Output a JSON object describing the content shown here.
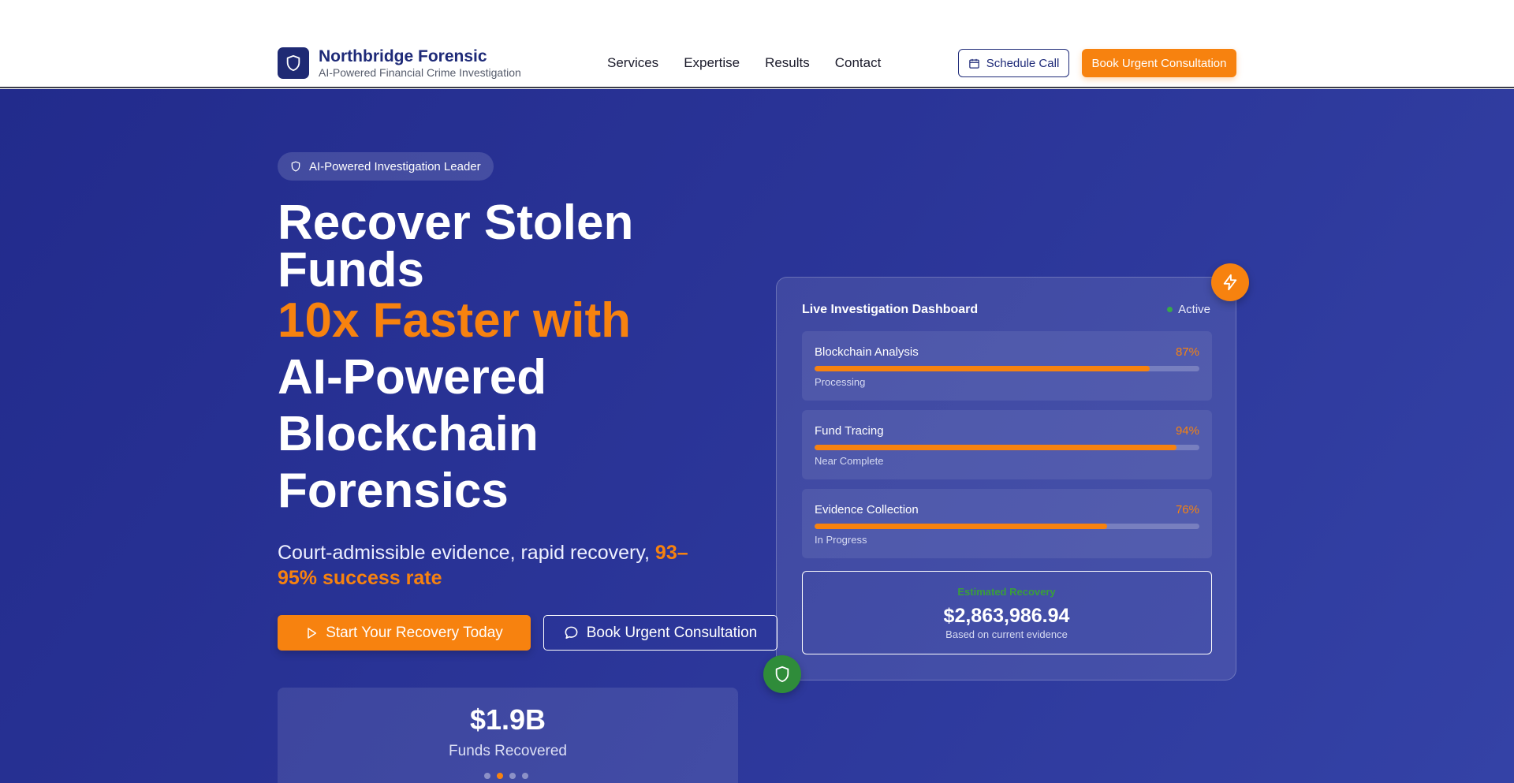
{
  "brand": {
    "title": "Northbridge Forensic",
    "subtitle": "AI-Powered Financial Crime Investigation",
    "logo_icon": "shield-icon"
  },
  "nav": {
    "items": [
      "Services",
      "Expertise",
      "Results",
      "Contact"
    ]
  },
  "header_actions": {
    "schedule_label": "Schedule Call",
    "schedule_icon": "calendar-icon",
    "urgent_label": "Book Urgent Consultation"
  },
  "hero": {
    "badge": "AI-Powered Investigation Leader",
    "headline": {
      "line1": "Recover Stolen",
      "line2": "Funds",
      "line3": "10x Faster with",
      "line4": "AI-Powered",
      "line5": "Blockchain",
      "line6": "Forensics"
    },
    "subtitle": "Court-admissible evidence, rapid recovery,",
    "subtitle_accent": "93–95% success rate",
    "cta_primary": "Start Your Recovery Today",
    "cta_secondary": "Book Urgent Consultation"
  },
  "stat": {
    "value": "$1.9B",
    "label": "Funds Recovered",
    "dots": 4,
    "active_dot": 1
  },
  "dashboard": {
    "title": "Live Investigation Dashboard",
    "status": "Active",
    "tasks": [
      {
        "name": "Blockchain Analysis",
        "percent": "87%",
        "progress": 87,
        "state": "Processing"
      },
      {
        "name": "Fund Tracing",
        "percent": "94%",
        "progress": 94,
        "state": "Near Complete"
      },
      {
        "name": "Evidence Collection",
        "percent": "76%",
        "progress": 76,
        "state": "In Progress"
      }
    ],
    "recovery": {
      "label": "Estimated Recovery",
      "value": "$2,863,986.94",
      "note": "Based on current evidence"
    }
  },
  "colors": {
    "accent": "#f7820f",
    "brand": "#1e2a78",
    "success": "#2f8c3a",
    "hero_bg": "#2a3497"
  }
}
